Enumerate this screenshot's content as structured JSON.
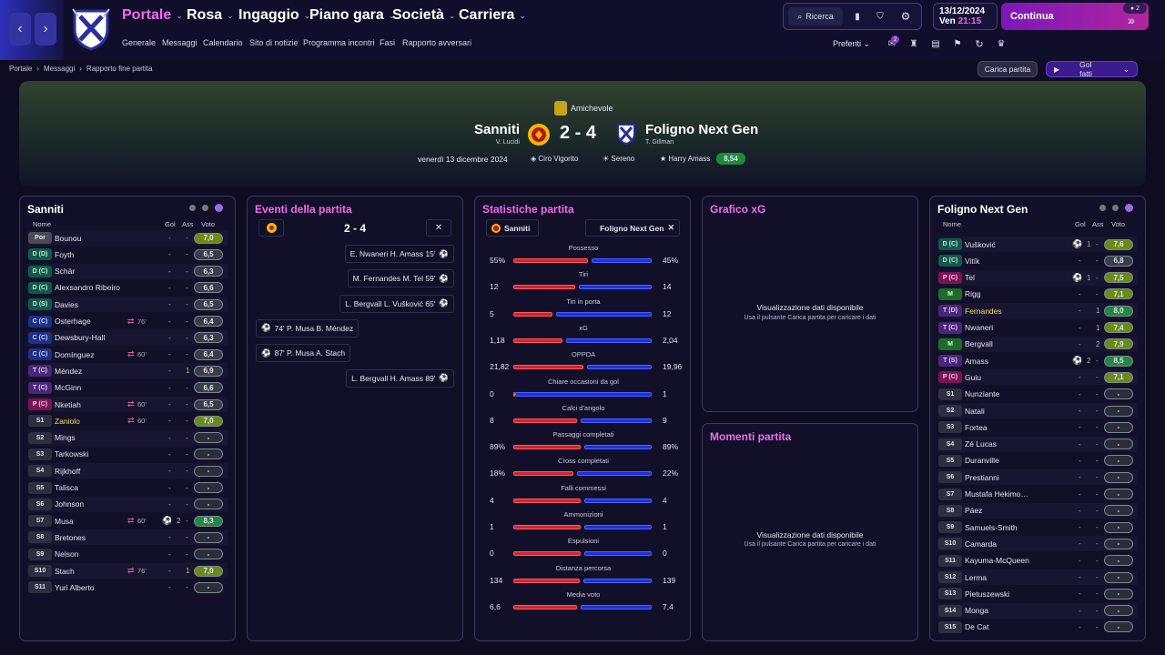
{
  "nav": {
    "menus": [
      "Portale",
      "Rosa",
      "Ingaggio",
      "Piano gara",
      "Società",
      "Carriera"
    ],
    "submenu": [
      "Generale",
      "Messaggi",
      "Calendario",
      "Sito di notizie",
      "Programma incontri",
      "Fasi",
      "Rapporto avversari"
    ],
    "search_label": "Ricerca",
    "date": "13/12/2024",
    "day": "Ven",
    "time": "21:15",
    "continue_label": "Continua",
    "notif_count": "2",
    "favorites_label": "Preferiti",
    "messages_badge": "2"
  },
  "breadcrumb": [
    "Portale",
    "Messaggi",
    "Rapporto fine partita"
  ],
  "actions": {
    "load_match": "Carica partita",
    "highlights": "Gol fatti"
  },
  "match": {
    "competition": "Amichevole",
    "home": "Sanniti",
    "home_manager": "V. Lucidi",
    "away": "Foligno Next Gen",
    "away_manager": "T. Gillman",
    "score": "2 - 4",
    "date": "venerdì 13 dicembre 2024",
    "stadium": "Ciro Vigorito",
    "weather": "Sereno",
    "mom": "Harry Amass",
    "mom_rating": "8,54"
  },
  "home_lineup": {
    "title": "Sanniti",
    "headers": {
      "name": "Nome",
      "goals": "Gol",
      "assists": "Ass",
      "rating": "Voto"
    },
    "players": [
      {
        "pos": "Por",
        "name": "Bounou",
        "sub": "",
        "goals": "-",
        "ass": "-",
        "rating": "7,0",
        "hl": false
      },
      {
        "pos": "D (D)",
        "name": "Foyth",
        "sub": "",
        "goals": "-",
        "ass": "-",
        "rating": "6,5",
        "hl": false
      },
      {
        "pos": "D (C)",
        "name": "Schär",
        "sub": "",
        "goals": "-",
        "ass": "-",
        "rating": "6,3",
        "hl": false
      },
      {
        "pos": "D (C)",
        "name": "Alexsandro Ribeiro",
        "sub": "",
        "goals": "-",
        "ass": "-",
        "rating": "6,6",
        "hl": false
      },
      {
        "pos": "D (S)",
        "name": "Davies",
        "sub": "",
        "goals": "-",
        "ass": "-",
        "rating": "6,5",
        "hl": false
      },
      {
        "pos": "C (C)",
        "name": "Osterhage",
        "sub": "76'",
        "goals": "-",
        "ass": "-",
        "rating": "6,4",
        "hl": false
      },
      {
        "pos": "C (C)",
        "name": "Dewsbury-Hall",
        "sub": "",
        "goals": "-",
        "ass": "-",
        "rating": "6,3",
        "hl": false
      },
      {
        "pos": "C (C)",
        "name": "Domínguez",
        "sub": "60'",
        "goals": "-",
        "ass": "-",
        "rating": "6,4",
        "hl": false
      },
      {
        "pos": "T (C)",
        "name": "Méndez",
        "sub": "",
        "goals": "-",
        "ass": "1",
        "rating": "6,9",
        "hl": false
      },
      {
        "pos": "T (C)",
        "name": "McGinn",
        "sub": "",
        "goals": "-",
        "ass": "-",
        "rating": "6,6",
        "hl": false
      },
      {
        "pos": "P (C)",
        "name": "Nketiah",
        "sub": "60'",
        "goals": "-",
        "ass": "-",
        "rating": "6,5",
        "hl": false
      },
      {
        "pos": "S1",
        "name": "Zaniolo",
        "sub": "60'",
        "goals": "-",
        "ass": "-",
        "rating": "7,0",
        "hl": true
      },
      {
        "pos": "S2",
        "name": "Mings",
        "sub": "",
        "goals": "-",
        "ass": "-",
        "rating": "-",
        "hl": false
      },
      {
        "pos": "S3",
        "name": "Tarkowski",
        "sub": "",
        "goals": "-",
        "ass": "-",
        "rating": "-",
        "hl": false
      },
      {
        "pos": "S4",
        "name": "Rijkhoff",
        "sub": "",
        "goals": "-",
        "ass": "-",
        "rating": "-",
        "hl": false
      },
      {
        "pos": "S5",
        "name": "Talisca",
        "sub": "",
        "goals": "-",
        "ass": "-",
        "rating": "-",
        "hl": false
      },
      {
        "pos": "S6",
        "name": "Johnson",
        "sub": "",
        "goals": "-",
        "ass": "-",
        "rating": "-",
        "hl": false
      },
      {
        "pos": "S7",
        "name": "Musa",
        "sub": "60'",
        "goals": "2",
        "ass": "-",
        "rating": "8,3",
        "hl": false
      },
      {
        "pos": "S8",
        "name": "Bretones",
        "sub": "",
        "goals": "-",
        "ass": "-",
        "rating": "-",
        "hl": false
      },
      {
        "pos": "S9",
        "name": "Nelson",
        "sub": "",
        "goals": "-",
        "ass": "-",
        "rating": "-",
        "hl": false
      },
      {
        "pos": "S10",
        "name": "Stach",
        "sub": "76'",
        "goals": "-",
        "ass": "1",
        "rating": "7,0",
        "hl": false
      },
      {
        "pos": "S11",
        "name": "Yuri Alberto",
        "sub": "",
        "goals": "-",
        "ass": "-",
        "rating": "-",
        "hl": false
      }
    ]
  },
  "events": {
    "title": "Eventi della partita",
    "score": "2 - 4",
    "items": [
      {
        "side": "away",
        "text": "E. Nwaneri  H. Amass  15'"
      },
      {
        "side": "away",
        "text": "M. Fernandes  M. Tel  59'"
      },
      {
        "side": "away",
        "text": "L. Bergvall  L. Vušković  65'"
      },
      {
        "side": "home",
        "text": "74'  P. Musa  B. Méndez"
      },
      {
        "side": "home",
        "text": "87'  P. Musa  A. Stach"
      },
      {
        "side": "away",
        "text": "L. Bergvall  H. Amass  89'"
      }
    ]
  },
  "stats": {
    "title": "Statistiche partita",
    "home": "Sanniti",
    "away": "Foligno Next Gen",
    "rows": [
      {
        "label": "Possesso",
        "home": "55%",
        "away": "45%",
        "h": 55,
        "a": 45
      },
      {
        "label": "Tiri",
        "home": "12",
        "away": "14",
        "h": 12,
        "a": 14
      },
      {
        "label": "Tiri in porta",
        "home": "5",
        "away": "12",
        "h": 5,
        "a": 12
      },
      {
        "label": "xG",
        "home": "1,18",
        "away": "2,04",
        "h": 1.18,
        "a": 2.04
      },
      {
        "label": "OPPDA",
        "home": "21,82",
        "away": "19,96",
        "h": 21.82,
        "a": 19.96
      },
      {
        "label": "Chiare occasioni da gol",
        "home": "0",
        "away": "1",
        "h": 0,
        "a": 1
      },
      {
        "label": "Calci d'angolo",
        "home": "8",
        "away": "9",
        "h": 8,
        "a": 9
      },
      {
        "label": "Passaggi completati",
        "home": "89%",
        "away": "89%",
        "h": 89,
        "a": 89
      },
      {
        "label": "Cross completati",
        "home": "18%",
        "away": "22%",
        "h": 18,
        "a": 22
      },
      {
        "label": "Falli commessi",
        "home": "4",
        "away": "4",
        "h": 4,
        "a": 4
      },
      {
        "label": "Ammonizioni",
        "home": "1",
        "away": "1",
        "h": 1,
        "a": 1
      },
      {
        "label": "Espulsioni",
        "home": "0",
        "away": "0",
        "h": 0,
        "a": 0
      },
      {
        "label": "Distanza percorsa",
        "home": "134",
        "away": "139",
        "h": 134,
        "a": 139
      },
      {
        "label": "Media voto",
        "home": "6,6",
        "away": "7,4",
        "h": 6.6,
        "a": 7.4
      }
    ]
  },
  "xg": {
    "title": "Grafico xG",
    "msg1": "Visualizzazione dati disponibile",
    "msg2": "Usa il pulsante Carica partita per caricare i dati"
  },
  "moments": {
    "title": "Momenti partita",
    "msg1": "Visualizzazione dati disponibile",
    "msg2": "Usa il pulsante Carica partita per caricare i dati"
  },
  "away_lineup": {
    "title": "Foligno Next Gen",
    "headers": {
      "name": "Nome",
      "goals": "Gol",
      "assists": "Ass",
      "rating": "Voto"
    },
    "players": [
      {
        "pos": "D (C)",
        "name": "Vušković",
        "sub": "",
        "goals": "1",
        "ass": "-",
        "rating": "7,6",
        "hl": false
      },
      {
        "pos": "D (C)",
        "name": "Vitík",
        "sub": "",
        "goals": "-",
        "ass": "-",
        "rating": "6,8",
        "hl": false
      },
      {
        "pos": "P (C)",
        "name": "Tel",
        "sub": "",
        "goals": "1",
        "ass": "-",
        "rating": "7,5",
        "hl": false
      },
      {
        "pos": "M",
        "name": "Rigg",
        "sub": "",
        "goals": "-",
        "ass": "-",
        "rating": "7,1",
        "hl": false
      },
      {
        "pos": "T (D)",
        "name": "Fernandes",
        "sub": "",
        "goals": "-",
        "ass": "1",
        "rating": "8,0",
        "hl": true
      },
      {
        "pos": "T (C)",
        "name": "Nwaneri",
        "sub": "",
        "goals": "-",
        "ass": "1",
        "rating": "7,4",
        "hl": false
      },
      {
        "pos": "M",
        "name": "Bergvall",
        "sub": "",
        "goals": "-",
        "ass": "2",
        "rating": "7,9",
        "hl": false
      },
      {
        "pos": "T (S)",
        "name": "Amass",
        "sub": "",
        "goals": "2",
        "ass": "-",
        "rating": "8,5",
        "hl": false
      },
      {
        "pos": "P (C)",
        "name": "Guiu",
        "sub": "",
        "goals": "-",
        "ass": "-",
        "rating": "7,1",
        "hl": false
      },
      {
        "pos": "S1",
        "name": "Nunziante",
        "sub": "",
        "goals": "-",
        "ass": "-",
        "rating": "-",
        "hl": false
      },
      {
        "pos": "S2",
        "name": "Natali",
        "sub": "",
        "goals": "-",
        "ass": "-",
        "rating": "-",
        "hl": false
      },
      {
        "pos": "S3",
        "name": "Fortea",
        "sub": "",
        "goals": "-",
        "ass": "-",
        "rating": "-",
        "hl": false
      },
      {
        "pos": "S4",
        "name": "Zé Lucas",
        "sub": "",
        "goals": "-",
        "ass": "-",
        "rating": "-",
        "hl": false
      },
      {
        "pos": "S5",
        "name": "Duranville",
        "sub": "",
        "goals": "-",
        "ass": "-",
        "rating": "-",
        "hl": false
      },
      {
        "pos": "S6",
        "name": "Prestianni",
        "sub": "",
        "goals": "-",
        "ass": "-",
        "rating": "-",
        "hl": false
      },
      {
        "pos": "S7",
        "name": "Mustafa Hekimo…",
        "sub": "",
        "goals": "-",
        "ass": "-",
        "rating": "-",
        "hl": false
      },
      {
        "pos": "S8",
        "name": "Páez",
        "sub": "",
        "goals": "-",
        "ass": "-",
        "rating": "-",
        "hl": false
      },
      {
        "pos": "S9",
        "name": "Samuels-Smith",
        "sub": "",
        "goals": "-",
        "ass": "-",
        "rating": "-",
        "hl": false
      },
      {
        "pos": "S10",
        "name": "Camarda",
        "sub": "",
        "goals": "-",
        "ass": "-",
        "rating": "-",
        "hl": false
      },
      {
        "pos": "S11",
        "name": "Kayuma-McQueen",
        "sub": "",
        "goals": "-",
        "ass": "-",
        "rating": "-",
        "hl": false
      },
      {
        "pos": "S12",
        "name": "Lerma",
        "sub": "",
        "goals": "-",
        "ass": "-",
        "rating": "-",
        "hl": false
      },
      {
        "pos": "S13",
        "name": "Pietuszewski",
        "sub": "",
        "goals": "-",
        "ass": "-",
        "rating": "-",
        "hl": false
      },
      {
        "pos": "S14",
        "name": "Monga",
        "sub": "",
        "goals": "-",
        "ass": "-",
        "rating": "-",
        "hl": false
      },
      {
        "pos": "S15",
        "name": "De Cat",
        "sub": "",
        "goals": "-",
        "ass": "-",
        "rating": "-",
        "hl": false
      }
    ]
  },
  "colors": {
    "accent": "#f16bea",
    "home_bar": "#d8202e",
    "away_bar": "#1d2fe6",
    "continue": "#9b1ec6"
  }
}
